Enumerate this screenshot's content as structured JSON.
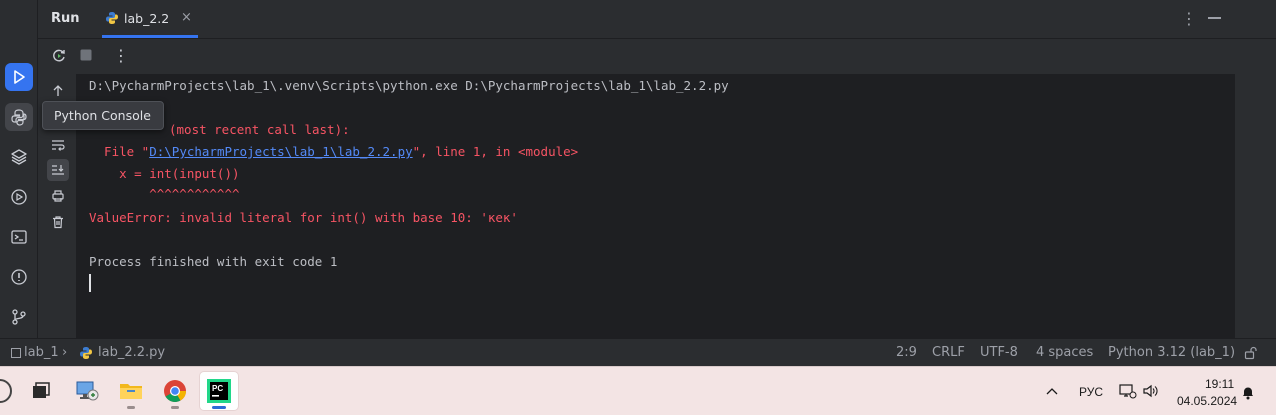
{
  "run_window": {
    "title": "Run",
    "tab": {
      "label": "lab_2.2",
      "close": "×"
    },
    "more": "⋮",
    "toolbar_more": "⋮"
  },
  "tooltip": {
    "text": "Python Console"
  },
  "console": {
    "command_line": "D:\\PycharmProjects\\lab_1\\.venv\\Scripts\\python.exe D:\\PycharmProjects\\lab_1\\lab_2.2.py",
    "traceback_visible": "(most recent call last):",
    "file_prefix": "  File \"",
    "file_link": "D:\\PycharmProjects\\lab_1\\lab_2.2.py",
    "file_suffix": "\", line 1, in <module>",
    "code_line": "    x = int(input())",
    "carets": "        ^^^^^^^^^^^^",
    "error_line": "ValueError: invalid literal for int() with base 10: 'кек'",
    "exit_line": "Process finished with exit code 1"
  },
  "statusbar": {
    "project": "lab_1",
    "separator": "›",
    "file": "lab_2.2.py",
    "position": "2:9",
    "line_ending": "CRLF",
    "encoding": "UTF-8",
    "indent": "4 spaces",
    "interpreter": "Python 3.12 (lab_1)"
  },
  "taskbar": {
    "language": "РУС",
    "time": "19:11",
    "date": "04.05.2024",
    "apps": [
      "task-view",
      "network-settings",
      "file-explorer",
      "chrome",
      "pycharm"
    ]
  },
  "colors": {
    "accent": "#3574f0",
    "error_text": "#f75464",
    "link": "#548af7",
    "console_text": "#bcbec4",
    "background": "#1e1f22",
    "panel": "#2b2d30"
  }
}
